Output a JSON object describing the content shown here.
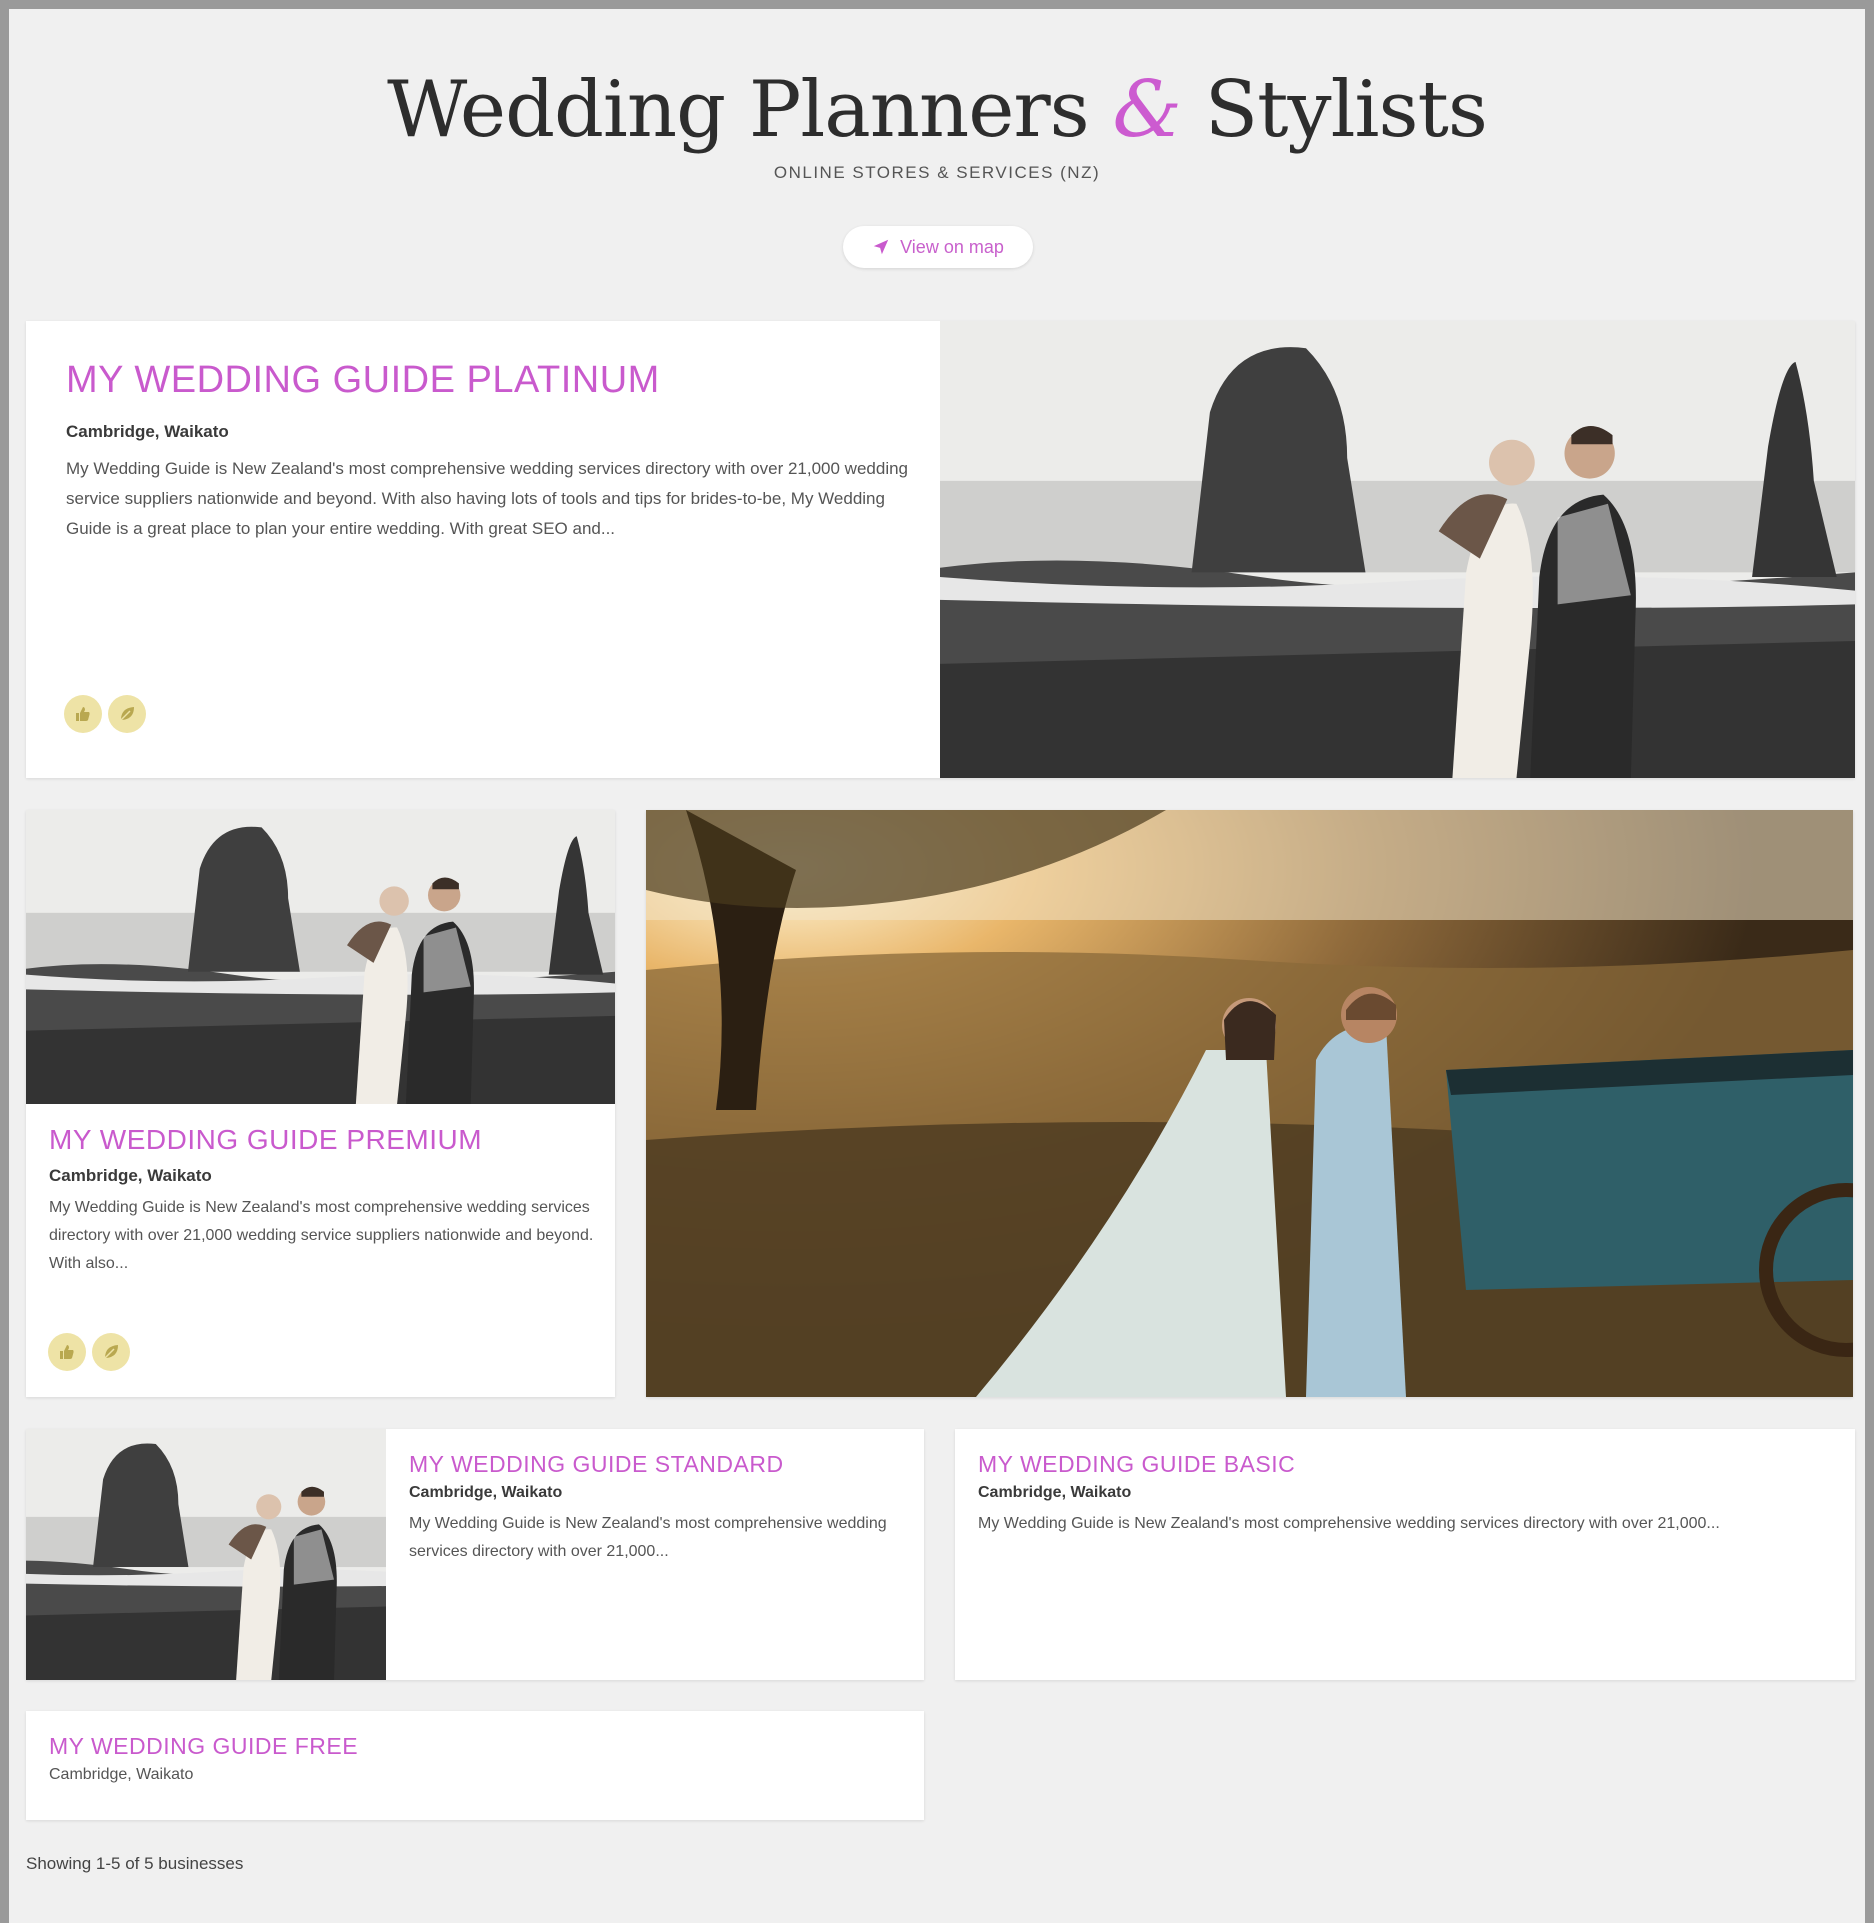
{
  "header": {
    "title_part1": "Wedding Planners",
    "title_amp": "&",
    "title_part2": "Stylists",
    "subtitle": "ONLINE STORES & SERVICES (NZ)",
    "map_button": "View on map"
  },
  "listings": [
    {
      "title": "MY WEDDING GUIDE PLATINUM",
      "location": "Cambridge, Waikato",
      "description": "My Wedding Guide is New Zealand's most comprehensive wedding services directory with over 21,000 wedding service suppliers nationwide and beyond. With also having lots of tools and tips for brides-to-be, My Wedding Guide is a great place to plan your entire wedding. With great SEO and...",
      "badges": [
        "thumbs-up-icon",
        "leaf-icon"
      ],
      "image": "beach couple kissing, black sand, sea stacks"
    },
    {
      "title": "MY WEDDING GUIDE PREMIUM",
      "location": "Cambridge, Waikato",
      "description": "My Wedding Guide is New Zealand's most comprehensive wedding services directory with over 21,000 wedding service suppliers nationwide and beyond. With also...",
      "badges": [
        "thumbs-up-icon",
        "leaf-icon"
      ],
      "image": "beach couple kissing, black sand, sea stacks",
      "feature_image": "couple at sunset by blue wagon in field"
    },
    {
      "title": "MY WEDDING GUIDE STANDARD",
      "location": "Cambridge, Waikato",
      "description": "My Wedding Guide is New Zealand's most comprehensive wedding services directory with over 21,000...",
      "image": "beach couple kissing, black sand, sea stacks"
    },
    {
      "title": "MY WEDDING GUIDE BASIC",
      "location": "Cambridge, Waikato",
      "description": "My Wedding Guide is New Zealand's most comprehensive wedding services directory with over 21,000..."
    },
    {
      "title": "MY WEDDING GUIDE FREE",
      "location": "Cambridge, Waikato"
    }
  ],
  "footer": {
    "showing": "Showing 1-5 of 5 businesses"
  },
  "colors": {
    "accent": "#c95acd",
    "badge": "#eee3a6",
    "background": "#f0f0f0"
  }
}
